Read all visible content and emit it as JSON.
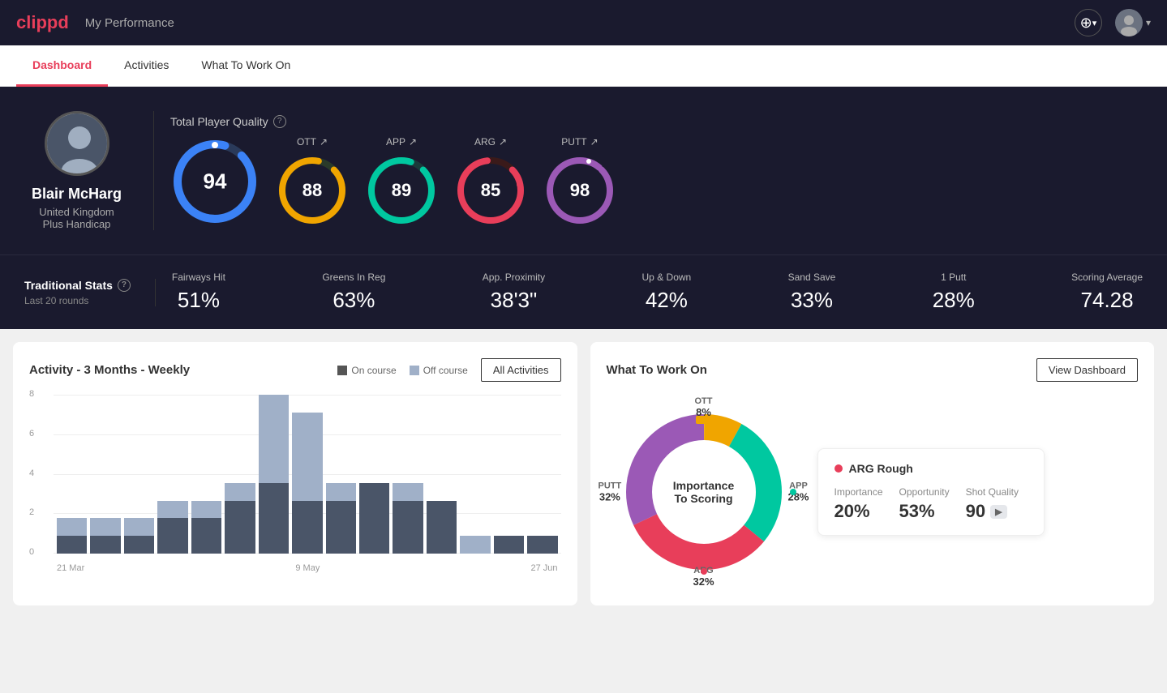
{
  "app": {
    "logo": "clippd",
    "header_title": "My Performance"
  },
  "nav": {
    "tabs": [
      {
        "id": "dashboard",
        "label": "Dashboard",
        "active": true
      },
      {
        "id": "activities",
        "label": "Activities",
        "active": false
      },
      {
        "id": "what-to-work-on",
        "label": "What To Work On",
        "active": false
      }
    ]
  },
  "player": {
    "name": "Blair McHarg",
    "country": "United Kingdom",
    "handicap": "Plus Handicap"
  },
  "quality": {
    "section_title": "Total Player Quality",
    "main_score": 94,
    "scores": [
      {
        "label": "OTT",
        "value": 88,
        "color": "#f0a500",
        "track": "#3a3a3a"
      },
      {
        "label": "APP",
        "value": 89,
        "color": "#00c8a0",
        "track": "#3a3a3a"
      },
      {
        "label": "ARG",
        "value": 85,
        "color": "#e83e5a",
        "track": "#3a3a3a"
      },
      {
        "label": "PUTT",
        "value": 98,
        "color": "#9b59b6",
        "track": "#3a3a3a"
      }
    ]
  },
  "traditional_stats": {
    "title": "Traditional Stats",
    "period": "Last 20 rounds",
    "stats": [
      {
        "label": "Fairways Hit",
        "value": "51%"
      },
      {
        "label": "Greens In Reg",
        "value": "63%"
      },
      {
        "label": "App. Proximity",
        "value": "38'3\""
      },
      {
        "label": "Up & Down",
        "value": "42%"
      },
      {
        "label": "Sand Save",
        "value": "33%"
      },
      {
        "label": "1 Putt",
        "value": "28%"
      },
      {
        "label": "Scoring Average",
        "value": "74.28"
      }
    ]
  },
  "activity_chart": {
    "title": "Activity - 3 Months - Weekly",
    "legend": {
      "on_course": "On course",
      "off_course": "Off course"
    },
    "all_activities_btn": "All Activities",
    "y_labels": [
      "8",
      "6",
      "4",
      "2",
      "0"
    ],
    "x_labels": [
      "21 Mar",
      "9 May",
      "27 Jun"
    ],
    "bars": [
      {
        "on": 1,
        "off": 1
      },
      {
        "on": 1,
        "off": 1
      },
      {
        "on": 1,
        "off": 1
      },
      {
        "on": 2,
        "off": 1
      },
      {
        "on": 2,
        "off": 1
      },
      {
        "on": 3,
        "off": 1
      },
      {
        "on": 4,
        "off": 5
      },
      {
        "on": 3,
        "off": 5
      },
      {
        "on": 3,
        "off": 1
      },
      {
        "on": 4,
        "off": 0
      },
      {
        "on": 3,
        "off": 1
      },
      {
        "on": 3,
        "off": 0
      },
      {
        "on": 0,
        "off": 1
      },
      {
        "on": 1,
        "off": 0
      },
      {
        "on": 1,
        "off": 0
      }
    ]
  },
  "what_to_work_on": {
    "title": "What To Work On",
    "view_dashboard_btn": "View Dashboard",
    "donut_center": "Importance\nTo Scoring",
    "segments": [
      {
        "label": "OTT",
        "value": "8%",
        "color": "#f0a500"
      },
      {
        "label": "APP",
        "value": "28%",
        "color": "#00c8a0"
      },
      {
        "label": "ARG",
        "value": "32%",
        "color": "#e83e5a"
      },
      {
        "label": "PUTT",
        "value": "32%",
        "color": "#9b59b6"
      }
    ],
    "detail": {
      "title": "ARG Rough",
      "dot_color": "#e83e5a",
      "metrics": [
        {
          "label": "Importance",
          "value": "20%"
        },
        {
          "label": "Opportunity",
          "value": "53%"
        },
        {
          "label": "Shot Quality",
          "value": "90",
          "badge": ""
        }
      ]
    }
  },
  "icons": {
    "plus": "+",
    "info": "?",
    "chevron_down": "▾",
    "arrow_up": "↗"
  }
}
